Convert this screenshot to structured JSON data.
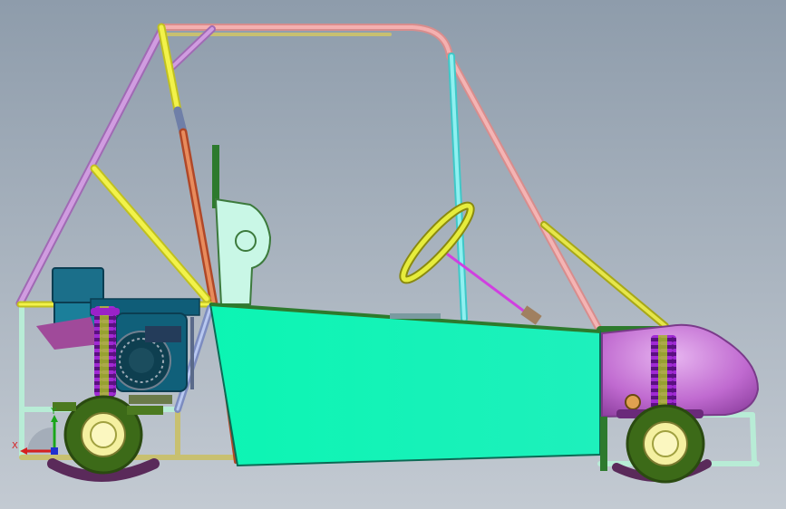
{
  "viewport": {
    "background_top": "#8e9cab",
    "background_bottom": "#c3cad2"
  },
  "triad": {
    "x_label": "X",
    "y_label": "Y",
    "x_color": "#d62020",
    "y_color": "#1aa51a",
    "z_color": "#2030d0"
  },
  "colors": {
    "body_panel": "#0cf5b3",
    "nose_cone": "#c06ad0",
    "frame_pink": "#f0a0a0",
    "frame_violet": "#c48ad8",
    "frame_yellow": "#ecec3a",
    "frame_cyan": "#60e8e8",
    "frame_light": "#b8ecd6",
    "frame_olive": "#c8c070",
    "spring": "#9a22c8",
    "damper": "#b0e010",
    "tire": "#4c7a20",
    "hub": "#f4f0a0",
    "engine_block": "#1b7f9a",
    "seat": "#c9f7e6",
    "steering_wheel": "#e6ec3c",
    "steering_column": "#d040e0"
  }
}
